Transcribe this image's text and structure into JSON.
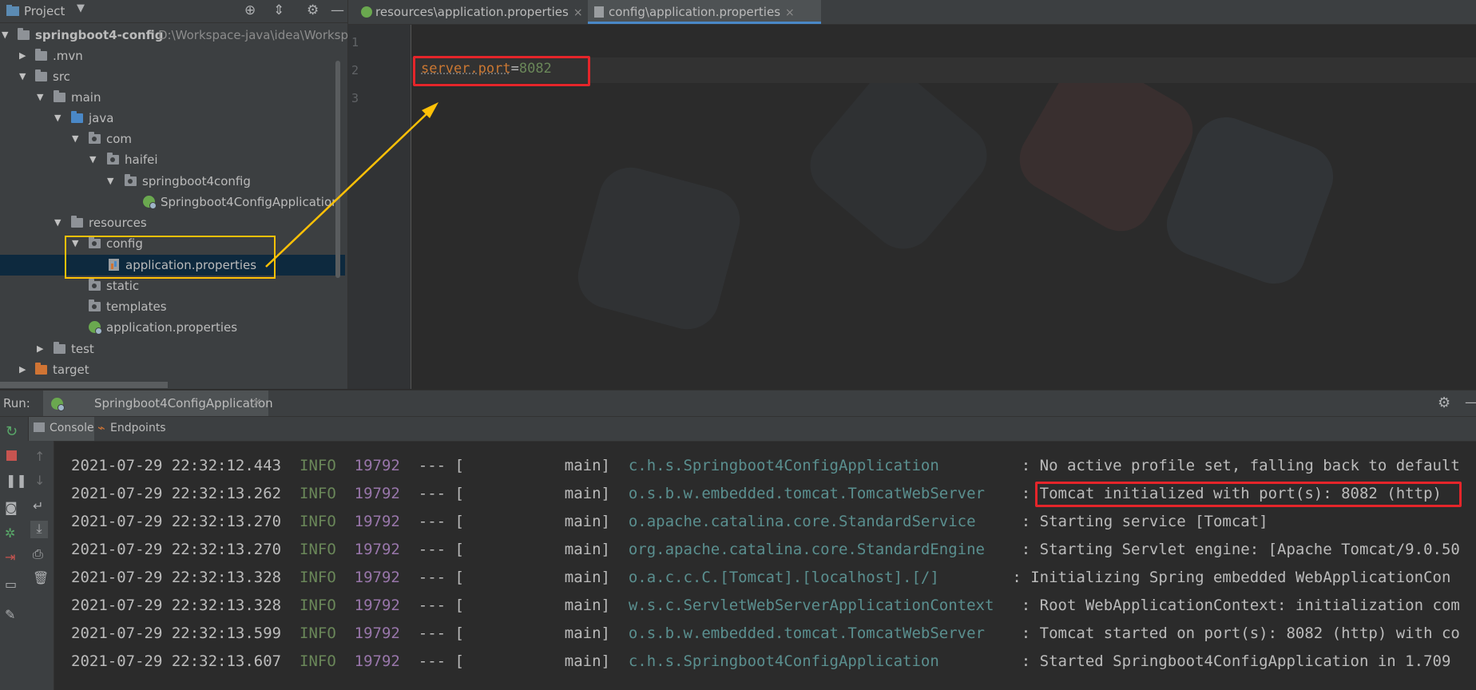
{
  "project": {
    "header_label": "Project",
    "tree": [
      {
        "label": "springboot4-config",
        "hint": "D:\\Workspace-java\\idea\\Worksp",
        "icon": "folder-icon",
        "bold": true
      },
      {
        "label": ".mvn",
        "icon": "folder-icon"
      },
      {
        "label": "src",
        "icon": "folder-icon"
      },
      {
        "label": "main",
        "icon": "folder-icon"
      },
      {
        "label": "java",
        "icon": "source-folder-icon"
      },
      {
        "label": "com",
        "icon": "package-icon"
      },
      {
        "label": "haifei",
        "icon": "package-icon"
      },
      {
        "label": "springboot4config",
        "icon": "package-icon"
      },
      {
        "label": "Springboot4ConfigApplication",
        "icon": "spring-boot-icon"
      },
      {
        "label": "resources",
        "icon": "resources-folder-icon"
      },
      {
        "label": "config",
        "icon": "package-icon"
      },
      {
        "label": "application.properties",
        "icon": "properties-file-icon"
      },
      {
        "label": "static",
        "icon": "package-icon"
      },
      {
        "label": "templates",
        "icon": "package-icon"
      },
      {
        "label": "application.properties",
        "icon": "spring-properties-icon"
      },
      {
        "label": "test",
        "icon": "folder-icon"
      },
      {
        "label": "target",
        "icon": "excluded-folder-icon"
      }
    ]
  },
  "editor": {
    "tabs": [
      {
        "label": "resources\\application.properties",
        "close": "×"
      },
      {
        "label": "config\\application.properties",
        "close": "×"
      }
    ],
    "line_numbers": [
      "1",
      "2",
      "3"
    ],
    "code": {
      "key": "server.port",
      "eq": "=",
      "value": "8082"
    }
  },
  "run": {
    "label": "Run:",
    "config_tab": "Springboot4ConfigApplication",
    "close": "×",
    "subtabs": [
      "Console",
      "Endpoints"
    ],
    "log": [
      {
        "ts": "2021-07-29 22:32:12.443",
        "lvl": "INFO",
        "pid": "19792",
        "sep": "--- [           main]",
        "cls": "c.h.s.Springboot4ConfigApplication       ",
        "msg": ": No active profile set, falling back to default"
      },
      {
        "ts": "2021-07-29 22:32:13.262",
        "lvl": "INFO",
        "pid": "19792",
        "sep": "--- [           main]",
        "cls": "o.s.b.w.embedded.tomcat.TomcatWebServer  ",
        "msg": ": Tomcat initialized with port(s): 8082 (http)"
      },
      {
        "ts": "2021-07-29 22:32:13.270",
        "lvl": "INFO",
        "pid": "19792",
        "sep": "--- [           main]",
        "cls": "o.apache.catalina.core.StandardService   ",
        "msg": ": Starting service [Tomcat]"
      },
      {
        "ts": "2021-07-29 22:32:13.270",
        "lvl": "INFO",
        "pid": "19792",
        "sep": "--- [           main]",
        "cls": "org.apache.catalina.core.StandardEngine  ",
        "msg": ": Starting Servlet engine: [Apache Tomcat/9.0.50"
      },
      {
        "ts": "2021-07-29 22:32:13.328",
        "lvl": "INFO",
        "pid": "19792",
        "sep": "--- [           main]",
        "cls": "o.a.c.c.C.[Tomcat].[localhost].[/]      ",
        "msg": ": Initializing Spring embedded WebApplicationCon"
      },
      {
        "ts": "2021-07-29 22:32:13.328",
        "lvl": "INFO",
        "pid": "19792",
        "sep": "--- [           main]",
        "cls": "w.s.c.ServletWebServerApplicationContext ",
        "msg": ": Root WebApplicationContext: initialization com"
      },
      {
        "ts": "2021-07-29 22:32:13.599",
        "lvl": "INFO",
        "pid": "19792",
        "sep": "--- [           main]",
        "cls": "o.s.b.w.embedded.tomcat.TomcatWebServer  ",
        "msg": ": Tomcat started on port(s): 8082 (http) with co"
      },
      {
        "ts": "2021-07-29 22:32:13.607",
        "lvl": "INFO",
        "pid": "19792",
        "sep": "--- [           main]",
        "cls": "c.h.s.Springboot4ConfigApplication       ",
        "msg": ": Started Springboot4ConfigApplication in 1.709"
      }
    ]
  },
  "colors": {
    "highlight_box": "#ffc107",
    "annotation_red": "#e5252a",
    "key_orange": "#cc7832",
    "value_green": "#6a8759",
    "pid_purple": "#9876aa",
    "class_teal": "#5a8f8f"
  }
}
